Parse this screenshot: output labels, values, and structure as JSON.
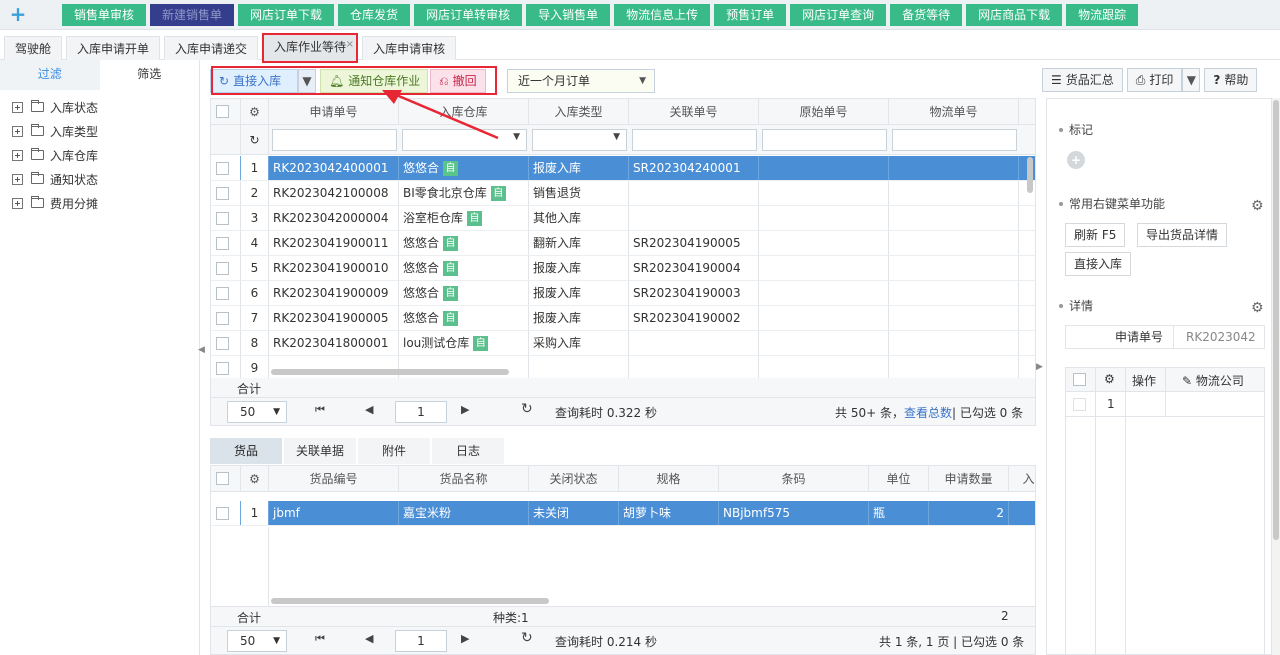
{
  "top_nav": {
    "add_icon": "plus-icon",
    "items": [
      {
        "label": "销售单审核"
      },
      {
        "label": "新建销售单",
        "active": true
      },
      {
        "label": "网店订单下载"
      },
      {
        "label": "仓库发货"
      },
      {
        "label": "网店订单转审核"
      },
      {
        "label": "导入销售单"
      },
      {
        "label": "物流信息上传"
      },
      {
        "label": "预售订单"
      },
      {
        "label": "网店订单查询"
      },
      {
        "label": "备货等待"
      },
      {
        "label": "网店商品下载"
      },
      {
        "label": "物流跟踪"
      }
    ]
  },
  "page_tabs": [
    {
      "label": "驾驶舱"
    },
    {
      "label": "入库申请开单"
    },
    {
      "label": "入库申请递交"
    },
    {
      "label": "入库作业等待",
      "active": true,
      "close": "×"
    },
    {
      "label": "入库申请审核"
    }
  ],
  "sidebar": {
    "tabs": [
      {
        "label": "过滤"
      },
      {
        "label": "筛选"
      }
    ],
    "tree": [
      {
        "label": "入库状态"
      },
      {
        "label": "入库类型"
      },
      {
        "label": "入库仓库"
      },
      {
        "label": "通知状态"
      },
      {
        "label": "费用分摊"
      }
    ]
  },
  "toolbar": {
    "direct_in": "直接入库",
    "notify": "通知仓库作业",
    "revoke": "撤回",
    "range": "近一个月订单",
    "goods_summary": "货品汇总",
    "print": "打印",
    "help": "帮助"
  },
  "main_grid": {
    "columns": [
      "申请单号",
      "入库仓库",
      "入库类型",
      "关联单号",
      "原始单号",
      "物流单号"
    ],
    "rows": [
      {
        "n": "1",
        "no": "RK2023042400001",
        "wh": "悠悠合",
        "auto": true,
        "type": "报废入库",
        "rel": "SR202304240001",
        "selected": true
      },
      {
        "n": "2",
        "no": "RK2023042100008",
        "wh": "BI零食北京仓库",
        "auto": true,
        "type": "销售退货",
        "rel": ""
      },
      {
        "n": "3",
        "no": "RK2023042000004",
        "wh": "浴室柜仓库",
        "auto": true,
        "type": "其他入库",
        "rel": ""
      },
      {
        "n": "4",
        "no": "RK2023041900011",
        "wh": "悠悠合",
        "auto": true,
        "type": "翻新入库",
        "rel": "SR202304190005"
      },
      {
        "n": "5",
        "no": "RK2023041900010",
        "wh": "悠悠合",
        "auto": true,
        "type": "报废入库",
        "rel": "SR202304190004"
      },
      {
        "n": "6",
        "no": "RK2023041900009",
        "wh": "悠悠合",
        "auto": true,
        "type": "报废入库",
        "rel": "SR202304190003"
      },
      {
        "n": "7",
        "no": "RK2023041900005",
        "wh": "悠悠合",
        "auto": true,
        "type": "报废入库",
        "rel": "SR202304190002"
      },
      {
        "n": "8",
        "no": "RK2023041800001",
        "wh": "lou测试仓库",
        "auto": true,
        "type": "采购入库",
        "rel": ""
      },
      {
        "n": "9",
        "no": "",
        "wh": "",
        "auto": false,
        "type": "",
        "rel": ""
      }
    ],
    "auto_tag": "自",
    "summary_label": "合计",
    "pager": {
      "page_size": "50",
      "page": "1",
      "elapsed": "查询耗时 0.322 秒",
      "total": "共 50+ 条，",
      "view_total": "查看总数",
      "selected": "| 已勾选 0 条"
    }
  },
  "bottom_tabs": [
    {
      "label": "货品"
    },
    {
      "label": "关联单据"
    },
    {
      "label": "附件"
    },
    {
      "label": "日志"
    }
  ],
  "detail_grid": {
    "columns": [
      "货品编号",
      "货品名称",
      "关闭状态",
      "规格",
      "条码",
      "单位",
      "申请数量",
      "入"
    ],
    "rows": [
      {
        "n": "1",
        "code": "jbmf",
        "name": "嘉宝米粉",
        "closed": "未关闭",
        "spec": "胡萝卜味",
        "barcode": "NBjbmf575",
        "unit": "瓶",
        "qty": "2"
      }
    ],
    "summary_label": "合计",
    "kinds": "种类:1",
    "sum_qty": "2",
    "pager": {
      "page_size": "50",
      "page": "1",
      "elapsed": "查询耗时 0.214 秒",
      "info": "共 1 条, 1 页 | 已勾选 0 条"
    }
  },
  "right_panel": {
    "mark_title": "标记",
    "context_title": "常用右键菜单功能",
    "context_buttons": [
      "刷新 F5",
      "导出货品详情",
      "直接入库"
    ],
    "detail_title": "详情",
    "detail_key": "申请单号",
    "detail_value": "RK2023042",
    "mini_cols": [
      "操作",
      "物流公司"
    ],
    "mini_row": "1"
  },
  "colors": {
    "accent": "#39ba89",
    "selected_row": "#4a8fd6",
    "highlight": "#e72733"
  }
}
